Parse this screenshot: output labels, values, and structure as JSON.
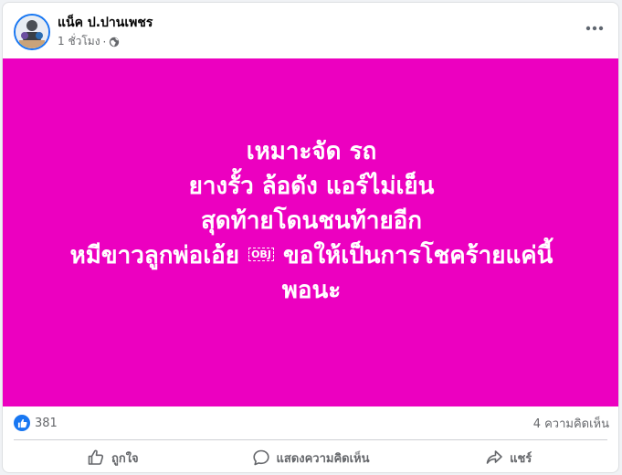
{
  "post": {
    "author": "แน็ค ป.ปานเพชร",
    "time": "1 ชั่วโมง",
    "separator": "·",
    "privacy_icon": "globe-icon",
    "more_icon": "more-icon",
    "image": {
      "background": "#ec00c0",
      "lines": [
        "เหมาะจัด รถ",
        "ยางรั้ว ล้อดัง แอร์ไม่เย็น",
        "สุดท้ายโดนชนท้ายอีก"
      ],
      "line4_before": "หมีขาวลูกพ่อเอ้ย",
      "line4_obj": "OBJ",
      "line4_after": "ขอให้เป็นการโชคร้ายแค่นี้",
      "line5": "พอนะ"
    }
  },
  "stats": {
    "reaction_icon": "like-icon",
    "reaction_count": "381",
    "comments": "4 ความคิดเห็น"
  },
  "actions": {
    "like": "ถูกใจ",
    "comment": "แสดงความคิดเห็น",
    "share": "แชร์"
  },
  "colors": {
    "accent": "#1877f2",
    "image_bg": "#ec00c0",
    "secondary_text": "#65676b"
  }
}
